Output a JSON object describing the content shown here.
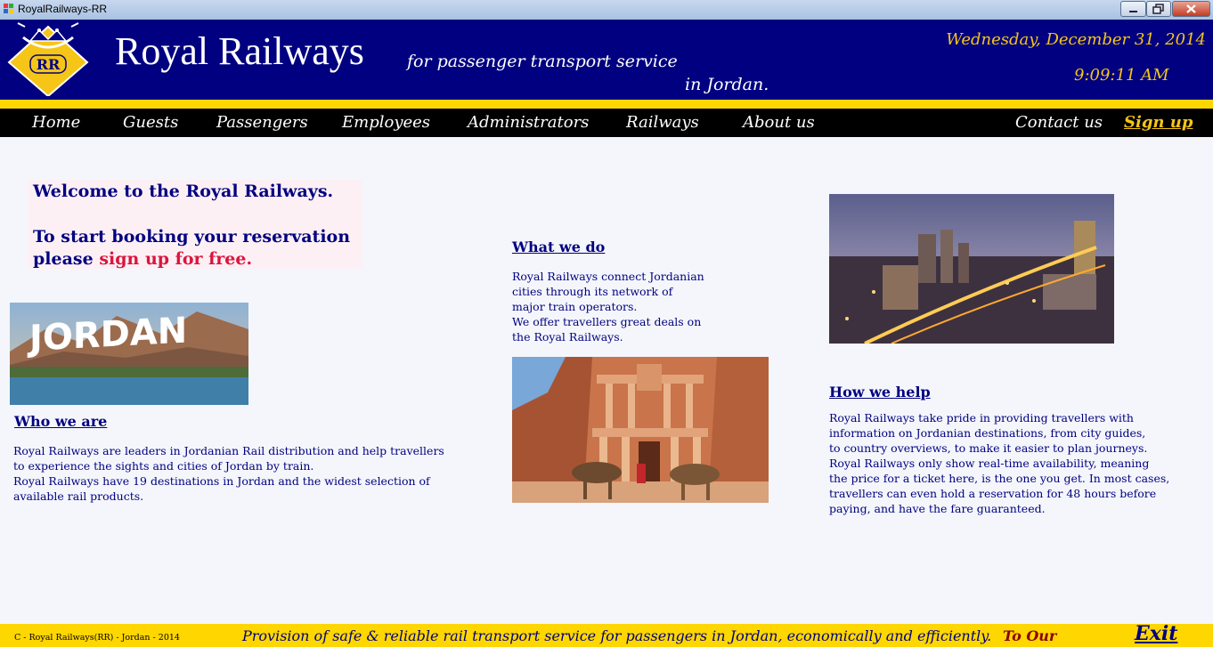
{
  "window": {
    "title": "RoyalRailways-RR"
  },
  "header": {
    "logo_text": "RR",
    "brand": "Royal Railways",
    "tagline_line1": "for passenger transport service",
    "tagline_line2": "in Jordan.",
    "date": "Wednesday, December 31, 2014",
    "time": "9:09:11 AM"
  },
  "nav": {
    "items": [
      "Home",
      "Guests",
      "Passengers",
      "Employees",
      "Administrators",
      "Railways",
      "About us"
    ],
    "contact": "Contact us",
    "signup": "Sign up"
  },
  "welcome": {
    "line1": "Welcome to the Royal Railways.",
    "line2": "To start booking your reservation",
    "line3_prefix": "please ",
    "line3_link": "sign up for free."
  },
  "images": {
    "jordan_sign_text": "JORDAN"
  },
  "who_we_are": {
    "heading": "Who we are",
    "lines": [
      "Royal Railways are leaders in Jordanian Rail distribution and help travellers",
      "to experience the sights and cities of Jordan by train.",
      "Royal Railways have 19 destinations in Jordan and the widest selection of",
      "available rail products."
    ]
  },
  "what_we_do": {
    "heading": "What we do",
    "lines": [
      "Royal Railways connect Jordanian",
      "cities through its network of",
      "major train operators.",
      "We offer travellers great deals on",
      "the Royal Railways."
    ]
  },
  "how_we_help": {
    "heading": "How we help",
    "lines": [
      "Royal Railways take pride in providing travellers with",
      "information on Jordanian destinations, from city guides,",
      "to country overviews, to make it easier to plan journeys.",
      "Royal Railways only show  real-time availability, meaning",
      "the price for a ticket here, is the one you get. In most cases,",
      "travellers can even hold a reservation for 48 hours before",
      "paying, and have the fare guaranteed."
    ]
  },
  "footer": {
    "copyright": "C - Royal Railways(RR) - Jordan - 2014",
    "provision": "Provision of safe & reliable rail transport service for passengers in Jordan, economically and efficiently.",
    "tour": "To Our",
    "exit": "Exit"
  },
  "colors": {
    "header_bg": "#000080",
    "accent_yellow": "#ffd700",
    "nav_bg": "#000000",
    "link_red": "#dc143c",
    "page_bg": "#f4f6fb"
  }
}
